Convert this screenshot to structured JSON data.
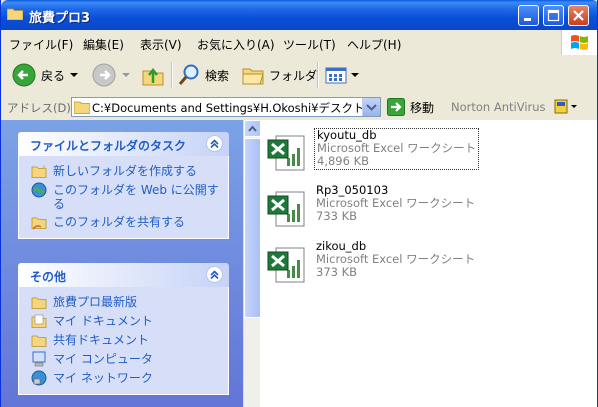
{
  "window": {
    "title": "旅費プロ3"
  },
  "menu": [
    "ファイル(F)",
    "編集(E)",
    "表示(V)",
    "お気に入り(A)",
    "ツール(T)",
    "ヘルプ(H)"
  ],
  "toolbar": {
    "back": "戻る",
    "search": "検索",
    "folders": "フォルダ"
  },
  "address": {
    "label": "アドレス(D)",
    "value": "C:¥Documents and Settings¥H.Okoshi¥デスクトップ",
    "go": "移動",
    "norton": "Norton AntiVirus"
  },
  "tasks": {
    "title": "ファイルとフォルダのタスク",
    "items": [
      "新しいフォルダを作成する",
      "このフォルダを Web に公開する",
      "このフォルダを共有する"
    ]
  },
  "other": {
    "title": "その他",
    "items": [
      "旅費プロ最新版",
      "マイ ドキュメント",
      "共有ドキュメント",
      "マイ コンピュータ",
      "マイ ネットワーク"
    ]
  },
  "files": [
    {
      "name": "kyoutu_db",
      "type": "Microsoft Excel ワークシート",
      "size": "4,896 KB"
    },
    {
      "name": "Rp3_050103",
      "type": "Microsoft Excel ワークシート",
      "size": "733 KB"
    },
    {
      "name": "zikou_db",
      "type": "Microsoft Excel ワークシート",
      "size": "373 KB"
    }
  ],
  "colors": {
    "titlebar": "#0a4fd8",
    "taskpane": "#6375d6",
    "link": "#215dc6"
  }
}
